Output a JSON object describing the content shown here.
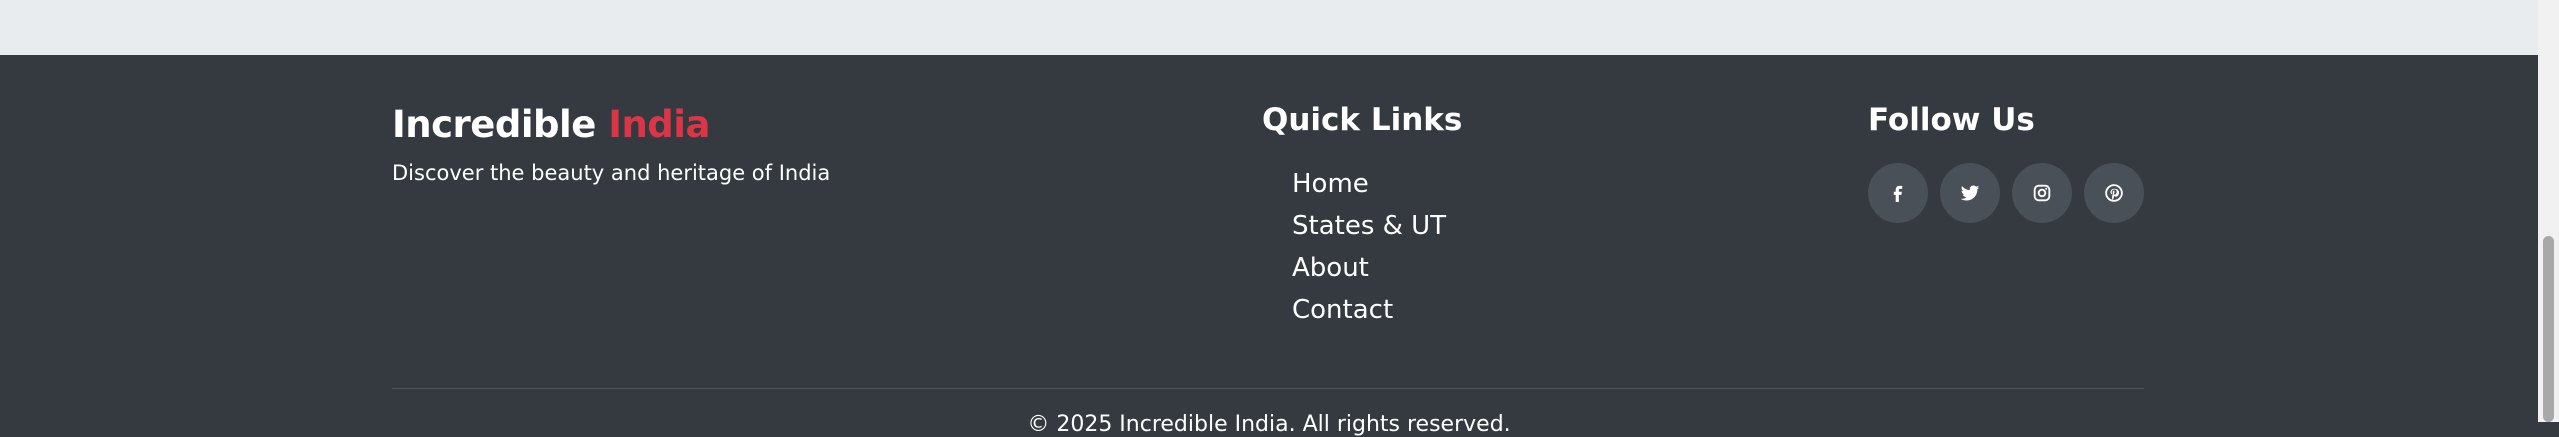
{
  "brand": {
    "name_primary": "Incredible",
    "name_accent": "India",
    "tagline": "Discover the beauty and heritage of India",
    "accent_color": "#dc3545"
  },
  "quick_links": {
    "heading": "Quick Links",
    "items": [
      {
        "label": "Home"
      },
      {
        "label": "States & UT"
      },
      {
        "label": "About"
      },
      {
        "label": "Contact"
      }
    ]
  },
  "follow": {
    "heading": "Follow Us",
    "icons": [
      "facebook-icon",
      "twitter-icon",
      "instagram-icon",
      "pinterest-icon"
    ]
  },
  "footer": {
    "copyright": "© 2025 Incredible India. All rights reserved.",
    "background_color": "#343a40"
  }
}
